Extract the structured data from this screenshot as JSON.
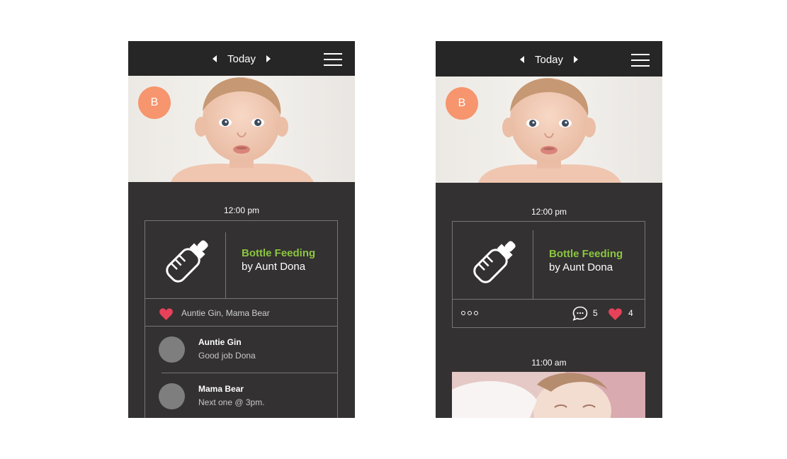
{
  "header": {
    "date_label": "Today"
  },
  "profile": {
    "initial": "B",
    "avatar_color": "#f6956e"
  },
  "colors": {
    "accent_green": "#8cc63f",
    "heart_red": "#e8415a",
    "panel_bg": "#333132",
    "header_bg": "#262626"
  },
  "left_screen": {
    "entry": {
      "time": "12:00 pm",
      "title": "Bottle Feeding",
      "subtitle": "by Aunt Dona",
      "icon": "baby-bottle-icon",
      "likes_text": "Auntie Gin, Mama Bear",
      "comments": [
        {
          "name": "Auntie Gin",
          "text": "Good job Dona"
        },
        {
          "name": "Mama Bear",
          "text": "Next one @ 3pm."
        }
      ]
    }
  },
  "right_screen": {
    "entry": {
      "time": "12:00 pm",
      "title": "Bottle Feeding",
      "subtitle": "by Aunt Dona",
      "icon": "baby-bottle-icon",
      "comment_count": "5",
      "like_count": "4"
    },
    "second_entry": {
      "time": "11:00 am"
    }
  }
}
